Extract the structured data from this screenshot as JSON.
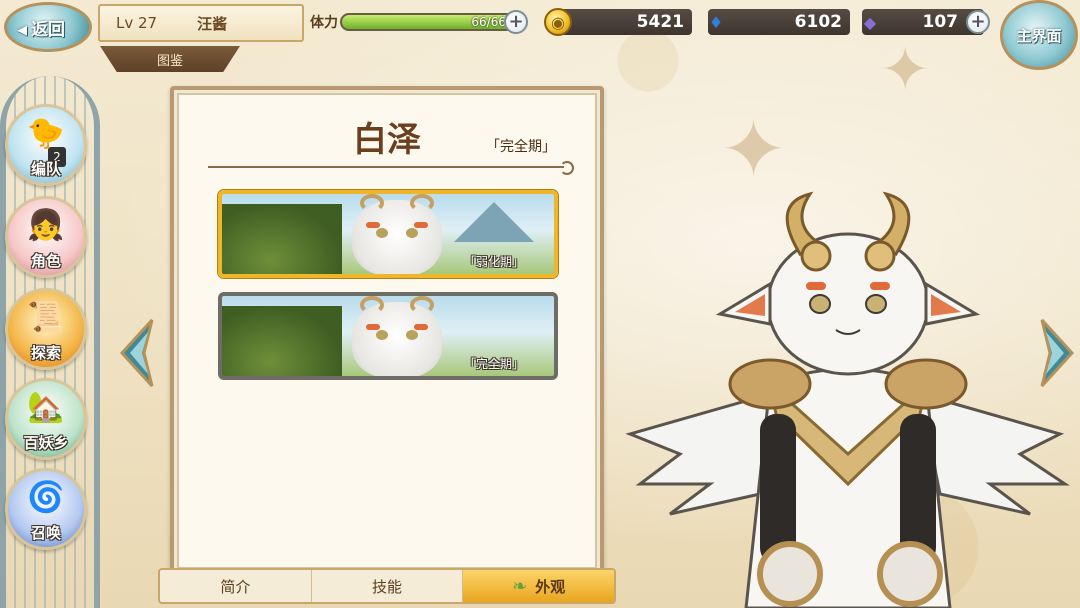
{
  "header": {
    "back_label": "返回",
    "level": "Lv 27",
    "player_name": "汪酱",
    "section_tab": "图鉴",
    "home_label": "主界面"
  },
  "resources": {
    "stamina_label": "体力",
    "stamina_text": "66/66",
    "stamina_fraction": 1.0,
    "coins": "5421",
    "souls": "6102",
    "gems": "107"
  },
  "side_menu": [
    {
      "label": "编队",
      "icon": "team-icon",
      "badge": "2"
    },
    {
      "label": "角色",
      "icon": "character-icon"
    },
    {
      "label": "探索",
      "icon": "explore-icon"
    },
    {
      "label": "百妖乡",
      "icon": "village-icon"
    },
    {
      "label": "召唤",
      "icon": "summon-icon"
    }
  ],
  "book": {
    "title": "白泽",
    "stage": "「完全期」",
    "forms": [
      {
        "label": "「弱化期」",
        "selected": true
      },
      {
        "label": "「完全期」",
        "selected": false
      }
    ]
  },
  "tabs": [
    {
      "label": "简介",
      "active": false
    },
    {
      "label": "技能",
      "active": false
    },
    {
      "label": "外观",
      "active": true
    }
  ],
  "colors": {
    "accent_gold": "#eaa51f",
    "panel_border": "#b89a72",
    "title_brown": "#6b3f1d",
    "stamina_green": "#6db02a"
  }
}
